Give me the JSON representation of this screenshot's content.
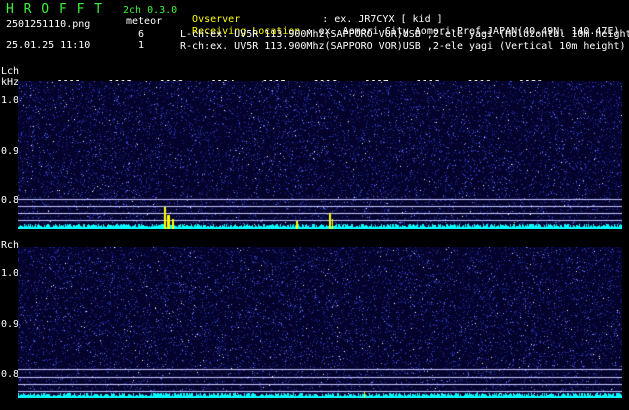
{
  "header": {
    "title": "H R O F F T",
    "filename": "2501251110.png",
    "datetime": "25.01.25 11:10",
    "mode": "2ch 0.3.0",
    "meteor_label": "meteor",
    "lch_count": "6",
    "rch_count": "1"
  },
  "info": {
    "observer_label": "Ovserver",
    "observer_value": ": ex. JR7CYX [ kid ]",
    "location_label": "Receiving Location",
    "location_value": ": ex. Aomori City Aomori-Pref.JAPAN(40.49N, 140.47E)",
    "lch_line": "L-ch:ex. UV5R 113.900Mhz(SAPPORO VOR)USB ,2-ele yagi (Holozontal 10m height)",
    "rch_line": "R-ch:ex. UV5R 113.900Mhz(SAPPORO VOR)USB ,2-ele yagi (Vertical 10m height)"
  },
  "time_ticks": [
    "1111",
    "1112",
    "1113",
    "1114",
    "1115",
    "1116",
    "1117",
    "1118",
    "1119",
    "1120"
  ],
  "lch": {
    "label": "Lch",
    "unit": "kHz",
    "yticks": [
      "1.0",
      "0.9",
      "0.8"
    ]
  },
  "rch": {
    "label": "Rch",
    "yticks": [
      "1.0",
      "0.9",
      "0.8"
    ]
  },
  "colors": {
    "background": "#000000",
    "title": "#3cf03c",
    "spectrum": "#00ffff",
    "meteor": "#ffff00",
    "noise": "#4a5cff"
  }
}
